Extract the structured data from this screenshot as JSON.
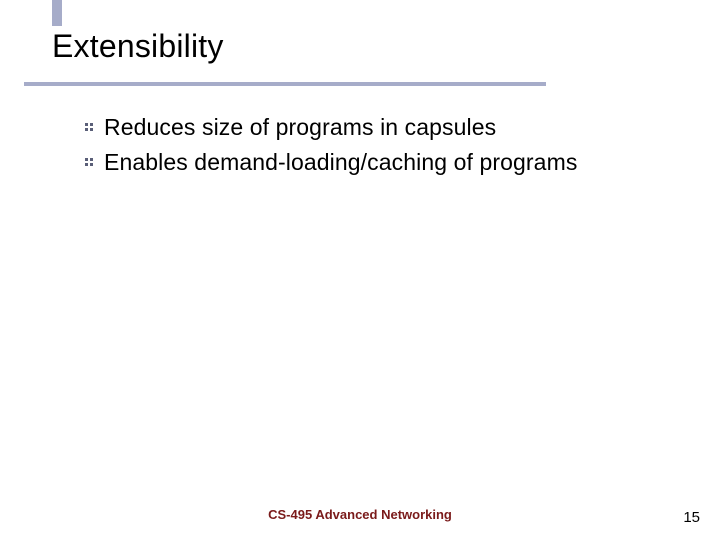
{
  "title": "Extensibility",
  "bullets": [
    "Reduces size of programs in capsules",
    "Enables demand-loading/caching of programs"
  ],
  "footer": "CS-495 Advanced Networking",
  "page_number": "15"
}
